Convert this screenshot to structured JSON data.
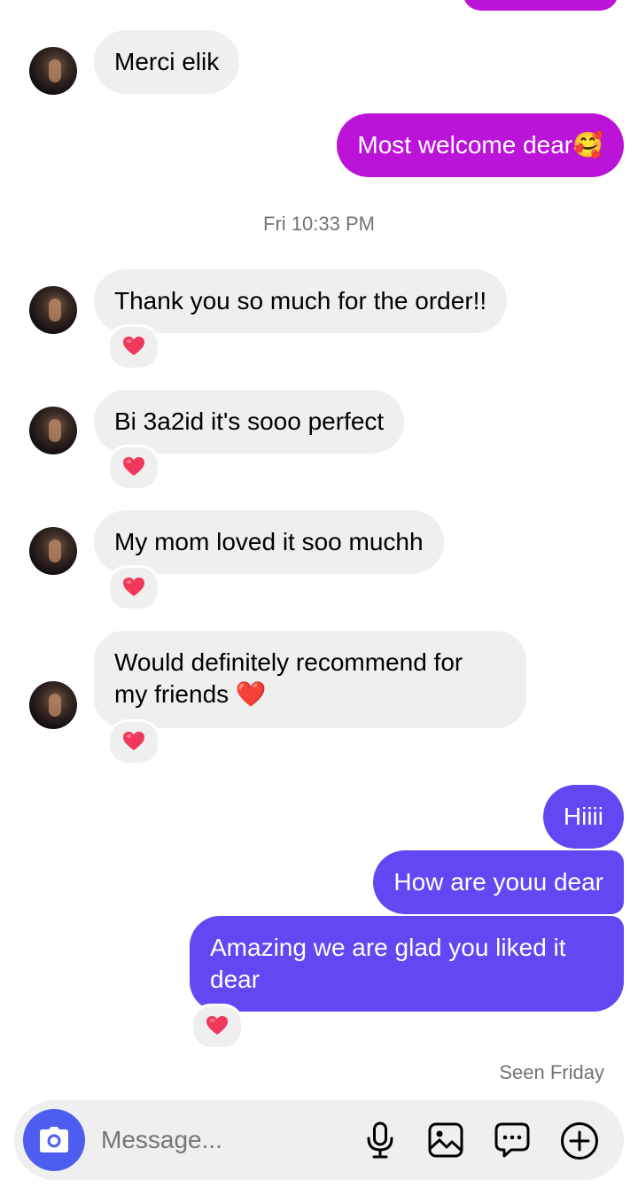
{
  "messages": {
    "m1": "Merci elik",
    "m2": "Most welcome dear🥰",
    "m3": "Thank you so much for the order!!",
    "m4": "Bi 3a2id it's sooo perfect",
    "m5": "My mom loved it soo muchh",
    "m6_line1": "Would definitely recommend for",
    "m6_line2": "my friends ❤️",
    "m7": "Hiiii",
    "m8": "How are youu dear",
    "m9_line1": "Amazing we are glad you liked it",
    "m9_line2": "dear"
  },
  "timestamp": "Fri 10:33 PM",
  "seen": "Seen Friday",
  "composer": {
    "placeholder": "Message...",
    "icons": [
      "camera-icon",
      "microphone-icon",
      "image-icon",
      "sticker-icon",
      "add-icon"
    ]
  },
  "colors": {
    "incoming_bubble": "#efefef",
    "outgoing_magenta": "#bb14d8",
    "outgoing_purple": "#6347f2",
    "accent_blue": "#4d5df0",
    "heart": "#f0385c"
  }
}
